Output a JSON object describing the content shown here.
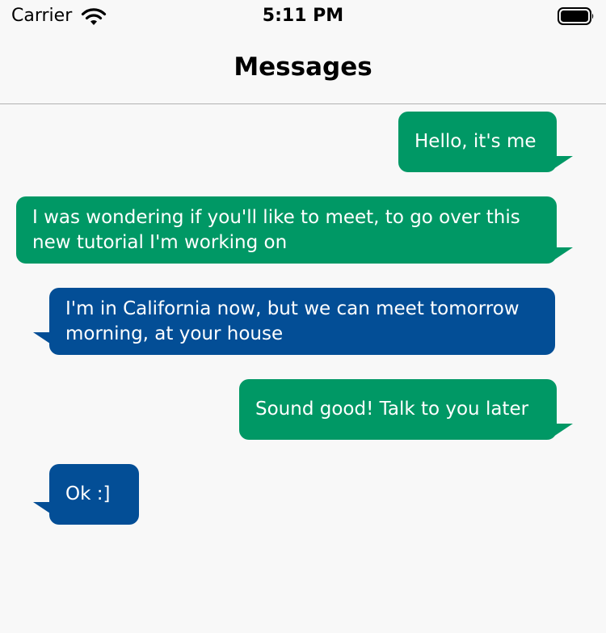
{
  "status_bar": {
    "carrier": "Carrier",
    "time": "5:11 PM",
    "wifi_icon": "wifi-icon",
    "battery_icon": "battery-icon"
  },
  "nav": {
    "title": "Messages"
  },
  "colors": {
    "outgoing_bubble": "#009865",
    "incoming_bubble": "#034e96",
    "background": "#f8f8f8"
  },
  "messages": [
    {
      "direction": "outgoing",
      "text": "Hello, it's me"
    },
    {
      "direction": "outgoing",
      "text": "I was wondering if you'll like to meet, to go over this new tutorial I'm working on"
    },
    {
      "direction": "incoming",
      "text": "I'm in California now, but we can meet tomorrow morning, at your house"
    },
    {
      "direction": "outgoing",
      "text": "Sound good! Talk to you later"
    },
    {
      "direction": "incoming",
      "text": "Ok :]"
    }
  ]
}
